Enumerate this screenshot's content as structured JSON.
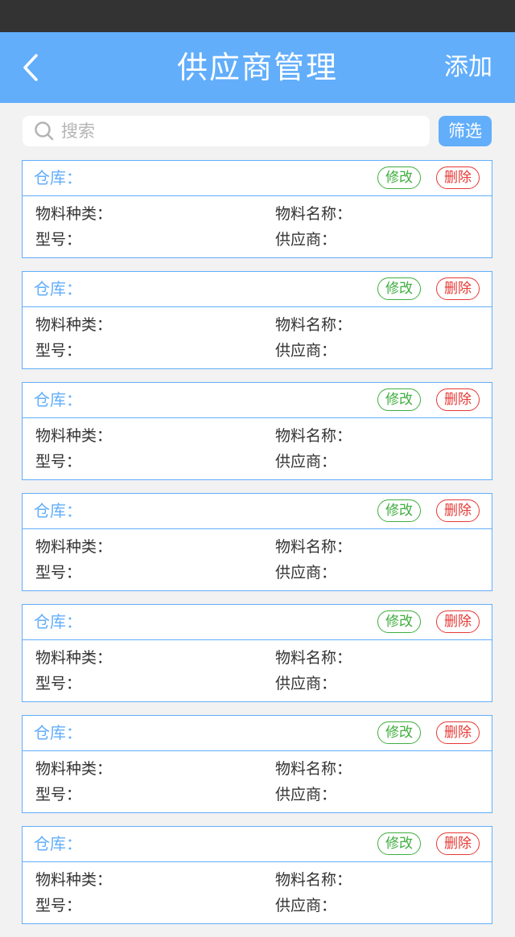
{
  "header": {
    "title": "供应商管理",
    "add_label": "添加"
  },
  "search": {
    "placeholder": "搜索",
    "filter_label": "筛选"
  },
  "cards": [
    {
      "warehouse_label": "仓库：",
      "edit_label": "修改",
      "delete_label": "删除",
      "material_type_label": "物料种类：",
      "material_name_label": "物料名称：",
      "model_label": "型号：",
      "supplier_label": "供应商："
    },
    {
      "warehouse_label": "仓库：",
      "edit_label": "修改",
      "delete_label": "删除",
      "material_type_label": "物料种类：",
      "material_name_label": "物料名称：",
      "model_label": "型号：",
      "supplier_label": "供应商："
    },
    {
      "warehouse_label": "仓库：",
      "edit_label": "修改",
      "delete_label": "删除",
      "material_type_label": "物料种类：",
      "material_name_label": "物料名称：",
      "model_label": "型号：",
      "supplier_label": "供应商："
    },
    {
      "warehouse_label": "仓库：",
      "edit_label": "修改",
      "delete_label": "删除",
      "material_type_label": "物料种类：",
      "material_name_label": "物料名称：",
      "model_label": "型号：",
      "supplier_label": "供应商："
    },
    {
      "warehouse_label": "仓库：",
      "edit_label": "修改",
      "delete_label": "删除",
      "material_type_label": "物料种类：",
      "material_name_label": "物料名称：",
      "model_label": "型号：",
      "supplier_label": "供应商："
    },
    {
      "warehouse_label": "仓库：",
      "edit_label": "修改",
      "delete_label": "删除",
      "material_type_label": "物料种类：",
      "material_name_label": "物料名称：",
      "model_label": "型号：",
      "supplier_label": "供应商："
    },
    {
      "warehouse_label": "仓库：",
      "edit_label": "修改",
      "delete_label": "删除",
      "material_type_label": "物料种类：",
      "material_name_label": "物料名称：",
      "model_label": "型号：",
      "supplier_label": "供应商："
    }
  ],
  "colors": {
    "primary": "#62aefb",
    "status_bar": "#333333",
    "edit": "#3fae3f",
    "delete": "#e53935",
    "background": "#f2f2f2"
  },
  "icons": {
    "back": "chevron-left-icon",
    "search": "search-icon"
  }
}
